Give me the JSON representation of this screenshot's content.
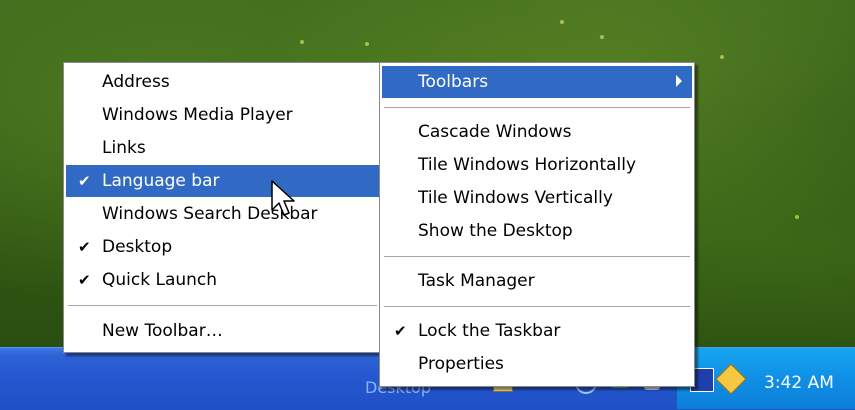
{
  "submenu_toolbars": {
    "items": [
      {
        "label": "Address",
        "checked": false
      },
      {
        "label": "Windows Media Player",
        "checked": false
      },
      {
        "label": "Links",
        "checked": false
      },
      {
        "label": "Language bar",
        "checked": true,
        "highlighted": true
      },
      {
        "label": "Windows Search Deskbar",
        "checked": false
      },
      {
        "label": "Desktop",
        "checked": true
      },
      {
        "label": "Quick Launch",
        "checked": true
      }
    ],
    "new_toolbar": "New Toolbar…"
  },
  "context_menu": {
    "toolbars": "Toolbars",
    "cascade": "Cascade Windows",
    "tile_h": "Tile Windows Horizontally",
    "tile_v": "Tile Windows Vertically",
    "show_desktop": "Show the Desktop",
    "task_manager": "Task Manager",
    "lock_taskbar": "Lock the Taskbar",
    "properties": "Properties"
  },
  "taskbar": {
    "desktop_toolbar_label": "Desktop",
    "clock": "3:42 AM"
  },
  "check_glyph": "✔",
  "colors": {
    "highlight": "#316ac5",
    "taskbar": "#2457d0",
    "tray": "#0f8fe6"
  }
}
